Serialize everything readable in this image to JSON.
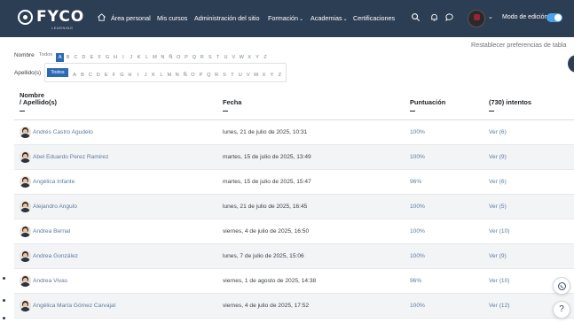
{
  "navbar": {
    "logo_text": "FYCO",
    "logo_subtext": "LEARNING",
    "items": [
      {
        "label": "Área personal",
        "dropdown": false
      },
      {
        "label": "Mis cursos",
        "dropdown": false
      },
      {
        "label": "Administración del sitio",
        "dropdown": false
      },
      {
        "label": "Formación",
        "dropdown": true
      },
      {
        "label": "Academias",
        "dropdown": true
      },
      {
        "label": "Certificaciones",
        "dropdown": false
      }
    ],
    "icons": [
      "home-icon",
      "search-icon",
      "bell-icon",
      "chat-icon"
    ],
    "edit_mode_label": "Modo de edición",
    "edit_mode_on": true,
    "caret": "⌄"
  },
  "filters": {
    "reset_label": "Restablecer preferencias de tabla",
    "first_name": {
      "label": "Nombre",
      "all_label": "Todos",
      "letters": [
        "A",
        "B",
        "C",
        "D",
        "E",
        "F",
        "G",
        "H",
        "I",
        "J",
        "K",
        "L",
        "M",
        "N",
        "Ñ",
        "O",
        "P",
        "Q",
        "R",
        "S",
        "T",
        "U",
        "V",
        "W",
        "X",
        "Y",
        "Z"
      ],
      "selected": "A"
    },
    "last_name": {
      "label": "Apellido(s)",
      "all_label": "Todos",
      "letters": [
        "A",
        "B",
        "C",
        "D",
        "E",
        "F",
        "G",
        "H",
        "I",
        "J",
        "K",
        "L",
        "M",
        "N",
        "Ñ",
        "O",
        "P",
        "Q",
        "R",
        "S",
        "T",
        "U",
        "V",
        "W",
        "X",
        "Y",
        "Z"
      ],
      "selected": "Todos"
    }
  },
  "table": {
    "headers": {
      "name_line1": "Nombre",
      "name_line2": "/ Apellido(s)",
      "date": "Fecha",
      "score": "Puntuación",
      "attempts": "(730) intentos"
    },
    "rows": [
      {
        "name": "Andrés Castro Agudelo",
        "date": "lunes, 21 de julio de 2025, 10:31",
        "score": "100%",
        "attempts": "Ver (6)"
      },
      {
        "name": "Abel Eduardo Perez Ramirez",
        "date": "martes, 15 de julio de 2025, 13:49",
        "score": "100%",
        "attempts": "Ver (9)"
      },
      {
        "name": "Angélica Infante",
        "date": "martes, 15 de julio de 2025, 15:47",
        "score": "96%",
        "attempts": "Ver (6)"
      },
      {
        "name": "Alejandro Angulo",
        "date": "lunes, 21 de julio de 2025, 16:45",
        "score": "100%",
        "attempts": "Ver (5)"
      },
      {
        "name": "Andrea Bernal",
        "date": "viernes, 4 de julio de 2025, 16:50",
        "score": "100%",
        "attempts": "Ver (10)"
      },
      {
        "name": "Andrea González",
        "date": "lunes, 7 de julio de 2025, 15:06",
        "score": "100%",
        "attempts": "Ver (9)"
      },
      {
        "name": "Andrea Vivas",
        "date": "viernes, 1 de agosto de 2025, 14:38",
        "score": "96%",
        "attempts": "Ver (10)"
      },
      {
        "name": "Angélica María Gómez Carvajal",
        "date": "viernes, 4 de julio de 2025, 17:52",
        "score": "100%",
        "attempts": "Ver (12)"
      }
    ]
  },
  "floating": {
    "whatsapp_icon": "whatsapp-icon",
    "help_label": "?"
  }
}
